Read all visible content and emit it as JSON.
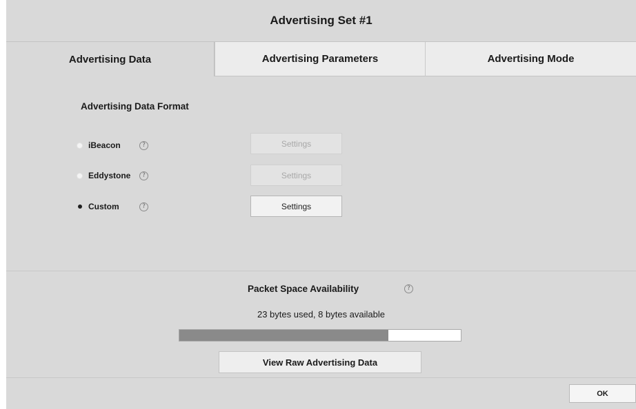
{
  "dialog": {
    "title": "Advertising Set #1"
  },
  "tabs": [
    {
      "label": "Advertising Data",
      "active": true
    },
    {
      "label": "Advertising Parameters",
      "active": false
    },
    {
      "label": "Advertising Mode",
      "active": false
    }
  ],
  "format": {
    "heading": "Advertising Data Format",
    "options": [
      {
        "label": "iBeacon",
        "selected": false,
        "settings_label": "Settings",
        "settings_enabled": false
      },
      {
        "label": "Eddystone",
        "selected": false,
        "settings_label": "Settings",
        "settings_enabled": false
      },
      {
        "label": "Custom",
        "selected": true,
        "settings_label": "Settings",
        "settings_enabled": true
      }
    ],
    "help_glyph": "?"
  },
  "packet": {
    "title": "Packet Space Availability",
    "status": "23 bytes used, 8 bytes available",
    "used_fraction": 0.742,
    "help_glyph": "?"
  },
  "buttons": {
    "view_raw": "View Raw Advertising Data",
    "ok": "OK"
  },
  "icons": {
    "help": "help-circle-icon"
  },
  "colors": {
    "background": "#d9d9d9",
    "inactive_tab": "#ececec",
    "progress_fill": "#8a8a8a"
  }
}
